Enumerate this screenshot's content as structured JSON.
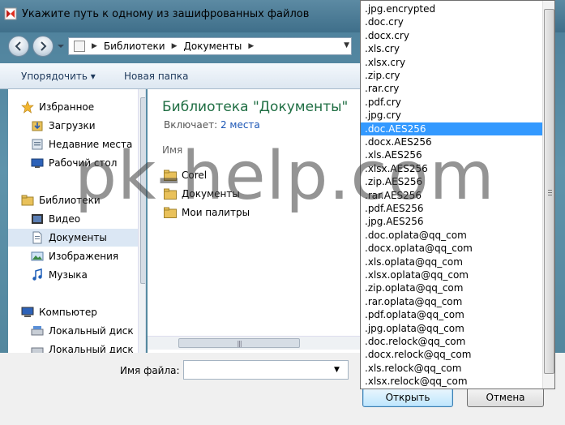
{
  "window": {
    "title": "Укажите путь к одному из зашифрованных файлов"
  },
  "address": {
    "crumbs": [
      "Библиотеки",
      "Документы"
    ]
  },
  "toolbar": {
    "organize_label": "Упорядочить ▾",
    "new_folder_label": "Новая папка"
  },
  "nav": {
    "items": [
      {
        "label": "Избранное",
        "icon": "star-icon"
      },
      {
        "label": "Загрузки",
        "icon": "downloads-icon"
      },
      {
        "label": "Недавние места",
        "icon": "recent-places-icon"
      },
      {
        "label": "Рабочий стол",
        "icon": "desktop-icon"
      },
      {
        "label": "Библиотеки",
        "icon": "libraries-icon"
      },
      {
        "label": "Видео",
        "icon": "video-icon"
      },
      {
        "label": "Документы",
        "icon": "documents-icon"
      },
      {
        "label": "Изображения",
        "icon": "images-icon"
      },
      {
        "label": "Музыка",
        "icon": "music-icon"
      },
      {
        "label": "Компьютер",
        "icon": "computer-icon"
      },
      {
        "label": "Локальный диск",
        "icon": "local-disk-icon"
      },
      {
        "label": "Локальный диск",
        "icon": "local-disk-icon"
      }
    ],
    "selected": "Документы"
  },
  "content": {
    "library_title": "Библиотека \"Документы\"",
    "includes_label": "Включает:",
    "includes_link": "2 места",
    "column_name": "Имя",
    "files": [
      "Corel",
      "Документы",
      "Мои палитры"
    ]
  },
  "bottom": {
    "filename_label": "Имя файла:",
    "filename_value": "",
    "open_button": "Открыть",
    "cancel_button": "Отмена"
  },
  "filetype_list": {
    "items": [
      ".jpg.encrypted",
      ".doc.cry",
      ".docx.cry",
      ".xls.cry",
      ".xlsx.cry",
      ".zip.cry",
      ".rar.cry",
      ".pdf.cry",
      ".jpg.cry",
      ".doc.AES256",
      ".docx.AES256",
      ".xls.AES256",
      ".xlsx.AES256",
      ".zip.AES256",
      ".rar.AES256",
      ".pdf.AES256",
      ".jpg.AES256",
      ".doc.oplata@qq_com",
      ".docx.oplata@qq_com",
      ".xls.oplata@qq_com",
      ".xlsx.oplata@qq_com",
      ".zip.oplata@qq_com",
      ".rar.oplata@qq_com",
      ".pdf.oplata@qq_com",
      ".jpg.oplata@qq_com",
      ".doc.relock@qq_com",
      ".docx.relock@qq_com",
      ".xls.relock@qq_com",
      ".xlsx.relock@qq_com"
    ],
    "selected": ".doc.AES256"
  },
  "watermark": "pk-help.com",
  "colors": {
    "accent": "#3399ff",
    "library_title": "#1f6e43",
    "link": "#1a55b5"
  }
}
